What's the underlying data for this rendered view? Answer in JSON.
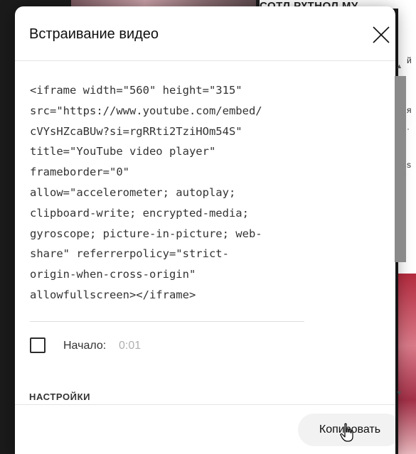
{
  "dialog": {
    "title": "Встраивание видео",
    "embed_code": "<iframe width=\"560\" height=\"315\"\nsrc=\"https://www.youtube.com/embed/\ncVYsHZcaBUw?si=rgRRti2TziHOm54S\"\ntitle=\"YouTube video player\"\nframeborder=\"0\"\nallow=\"accelerometer; autoplay;\nclipboard-write; encrypted-media;\ngyroscope; picture-in-picture; web-\nshare\" referrerpolicy=\"strict-\norigin-when-cross-origin\"\nallowfullscreen></iframe>",
    "start_label": "Начало:",
    "start_value": "0:01",
    "settings_header": "НАСТРОЙКИ",
    "copy_button": "Копировать"
  },
  "background": {
    "title_fragment": "СОТЛ РҮТНОЛ МУ",
    "snippets": [
      "й",
      "я",
      "·",
      "s"
    ]
  },
  "icons": {
    "close": "close-icon",
    "cursor": "hand-pointer-icon",
    "scroll_up": "scroll-up-arrow-icon",
    "scroll_down": "scroll-down-arrow-icon"
  },
  "colors": {
    "text": "#0f0f0f",
    "muted": "#b0b0b0",
    "button_bg": "#f2f2f2",
    "scroll_thumb": "#8a8a8a"
  }
}
